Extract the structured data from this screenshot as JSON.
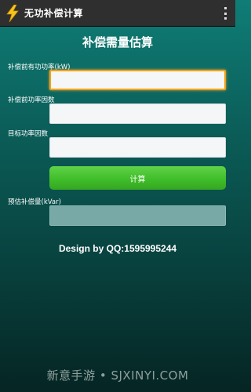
{
  "app_bar": {
    "title": "无功补偿计算",
    "icon": "lightning-bolt-icon",
    "menu_icon": "overflow-menu-icon"
  },
  "form": {
    "heading": "补偿需量估算",
    "fields": [
      {
        "label": "补偿前有功功率(kW)",
        "value": "",
        "focused": true
      },
      {
        "label": "补偿前功率因数",
        "value": ""
      },
      {
        "label": "目标功率因数",
        "value": ""
      }
    ],
    "calculate_label": "计算",
    "result_label": "预估补偿量(kVar)",
    "result_value": ""
  },
  "credit": "Design by QQ:1595995244",
  "watermark": "新意手游 • SJXINYI.COM",
  "colors": {
    "background_top": "#0f7d76",
    "background_bottom": "#052523",
    "action_bar": "#2f2f2f",
    "button_green": "#3fbb28",
    "focus_orange": "#f0a01c",
    "result_field": "#78a9a6"
  }
}
